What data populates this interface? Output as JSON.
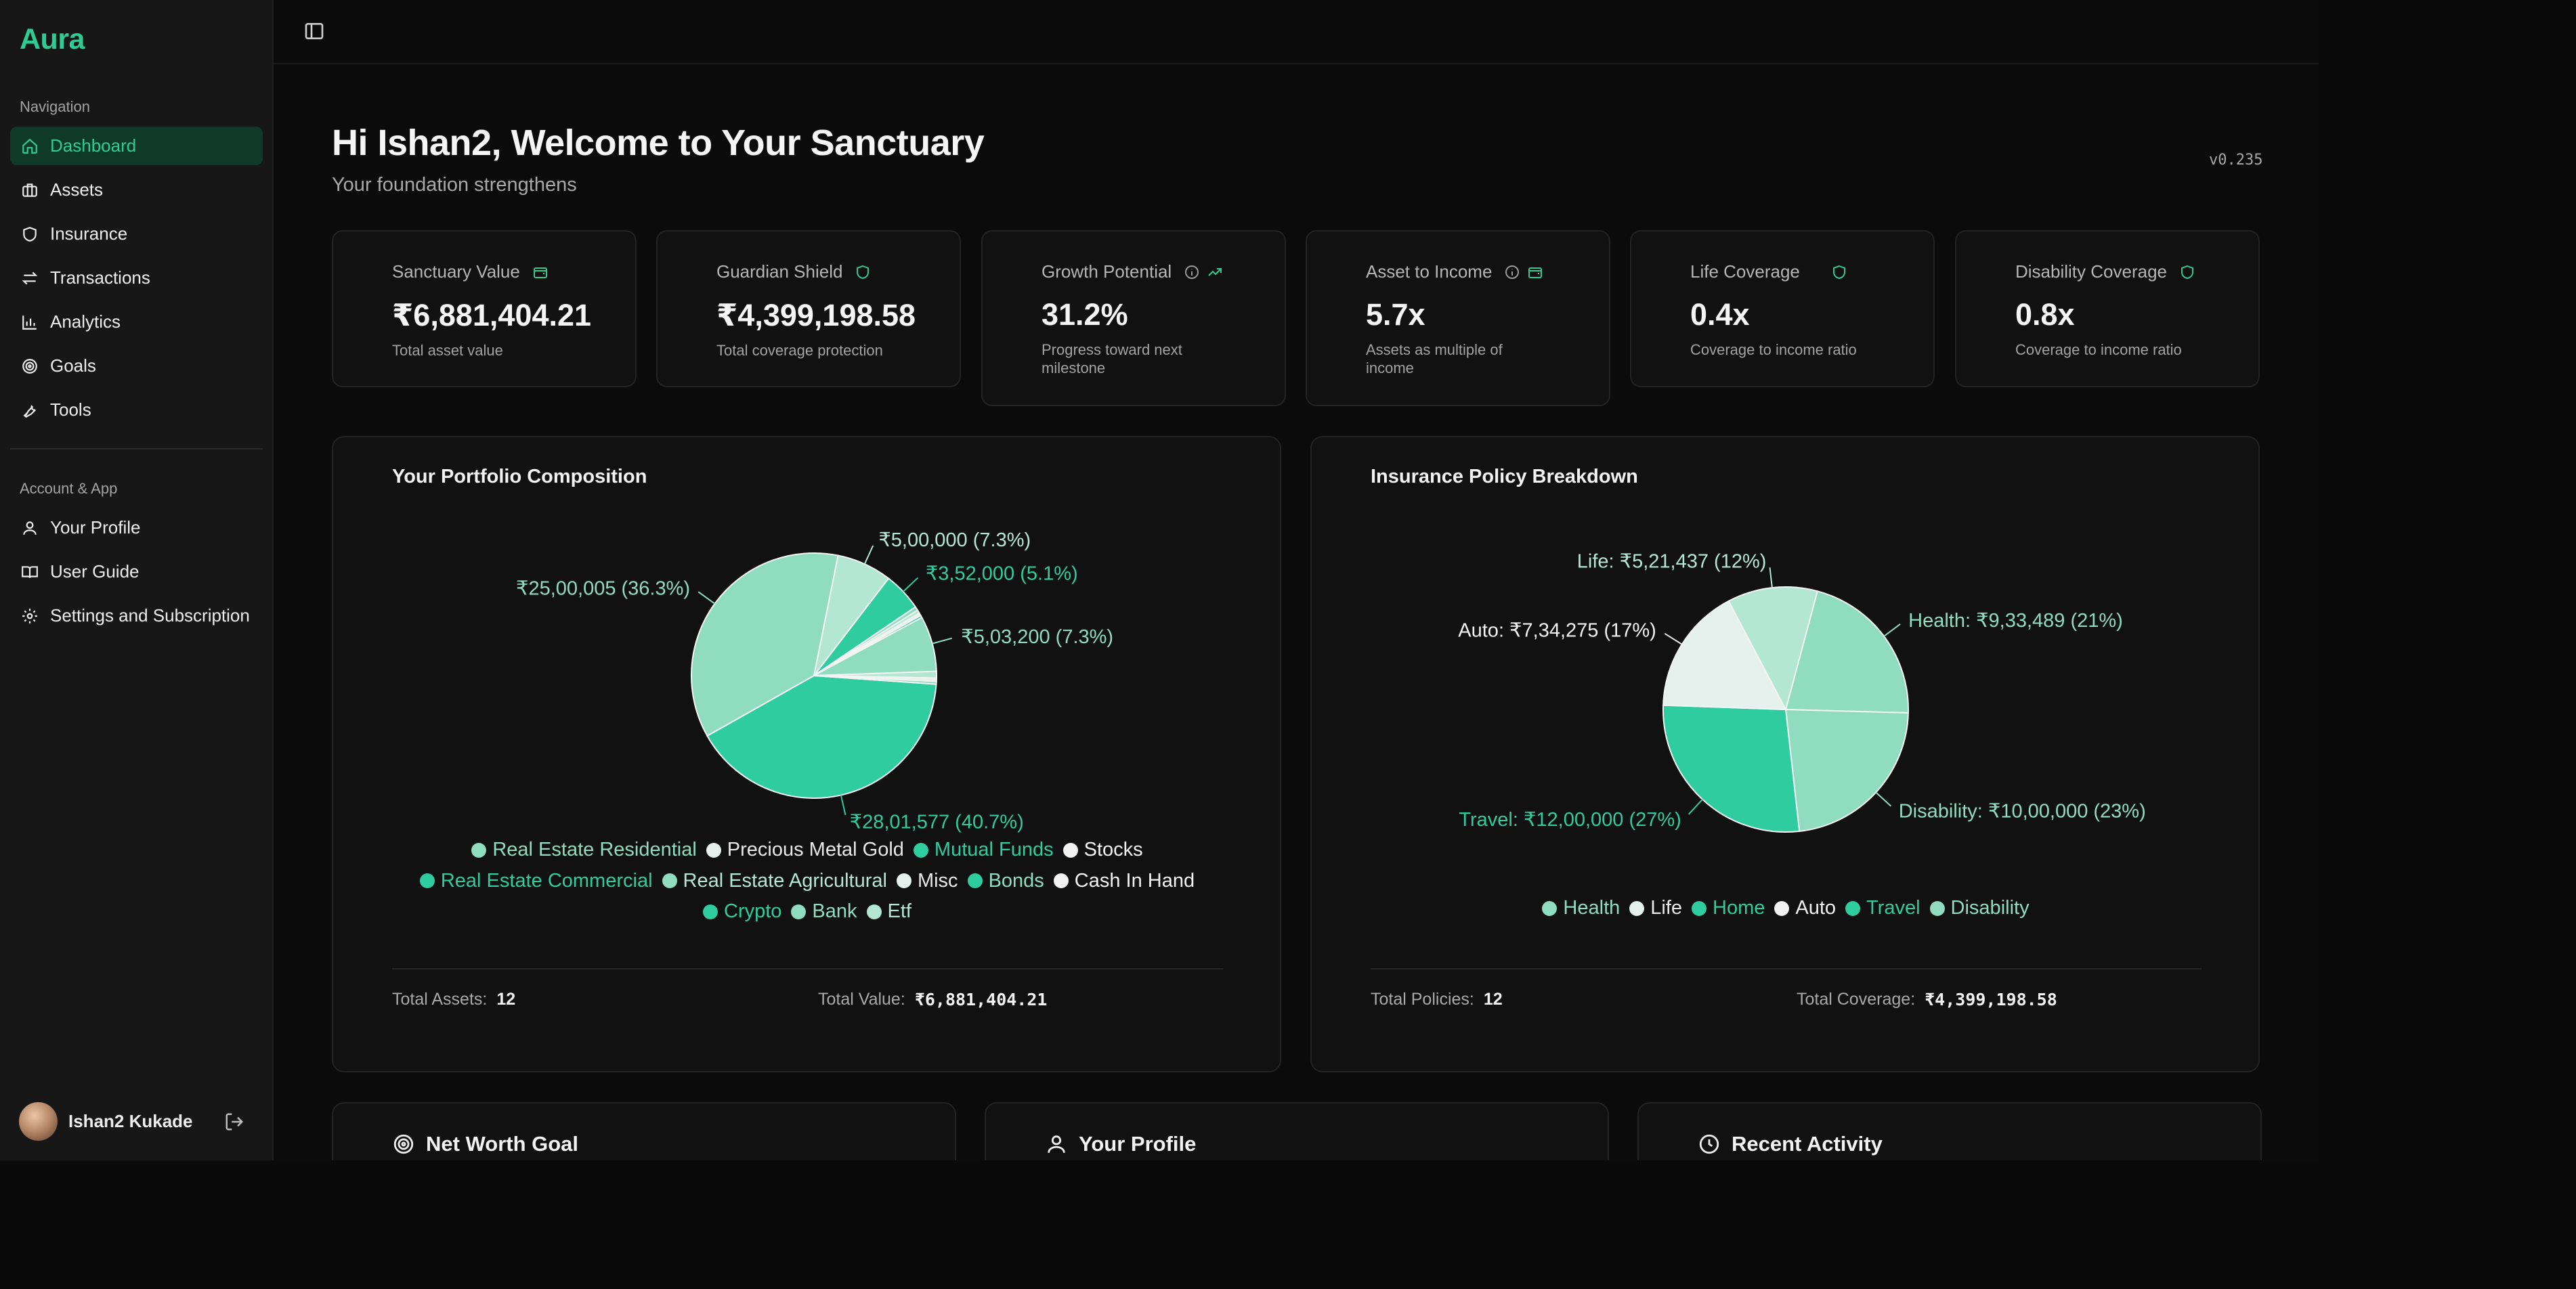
{
  "app": {
    "brand": "Aura",
    "version": "v0.235"
  },
  "sidebar": {
    "nav_label": "Navigation",
    "items": [
      {
        "label": "Dashboard",
        "icon": "home-icon",
        "active": true
      },
      {
        "label": "Assets",
        "icon": "briefcase-icon"
      },
      {
        "label": "Insurance",
        "icon": "shield-icon"
      },
      {
        "label": "Transactions",
        "icon": "arrows-icon"
      },
      {
        "label": "Analytics",
        "icon": "bar-chart-icon"
      },
      {
        "label": "Goals",
        "icon": "target-icon"
      },
      {
        "label": "Tools",
        "icon": "wrench-icon"
      }
    ],
    "account_label": "Account & App",
    "account_items": [
      {
        "label": "Your Profile",
        "icon": "user-icon"
      },
      {
        "label": "User Guide",
        "icon": "book-icon"
      },
      {
        "label": "Settings and Subscription",
        "icon": "gear-icon"
      }
    ],
    "user": {
      "name": "Ishan2 Kukade"
    }
  },
  "header": {
    "greeting": "Hi Ishan2, Welcome to Your Sanctuary",
    "subtitle": "Your foundation strengthens"
  },
  "stats": [
    {
      "label": "Sanctuary Value",
      "value": "₹6,881,404.21",
      "desc": "Total asset value"
    },
    {
      "label": "Guardian Shield",
      "value": "₹4,399,198.58",
      "desc": "Total coverage protection"
    },
    {
      "label": "Growth Potential",
      "value": "31.2%",
      "desc": "Progress toward next milestone"
    },
    {
      "label": "Asset to Income",
      "value": "5.7x",
      "desc": "Assets as multiple of income"
    },
    {
      "label": "Life Coverage",
      "value": "0.4x",
      "desc": "Coverage to income ratio"
    },
    {
      "label": "Disability Coverage",
      "value": "0.8x",
      "desc": "Coverage to income ratio"
    }
  ],
  "portfolio": {
    "title": "Your Portfolio Composition",
    "total_assets_label": "Total Assets:",
    "total_assets": "12",
    "total_value_label": "Total Value:",
    "total_value": "₹6,881,404.21"
  },
  "insurance": {
    "title": "Insurance Policy Breakdown",
    "total_policies_label": "Total Policies:",
    "total_policies": "12",
    "total_coverage_label": "Total Coverage:",
    "total_coverage": "₹4,399,198.58"
  },
  "bottom_cards": [
    {
      "title": "Net Worth Goal",
      "icon": "target-icon"
    },
    {
      "title": "Your Profile",
      "icon": "user-icon"
    },
    {
      "title": "Recent Activity",
      "icon": "clock-icon"
    }
  ],
  "colors": {
    "accent": "#2ecc94",
    "slices": [
      "#2ecc9f",
      "#8fdcc0",
      "#b4e6d4",
      "#e4f1ec"
    ]
  },
  "chart_data": [
    {
      "type": "pie",
      "title": "Your Portfolio Composition",
      "slices": [
        {
          "name": "Real Estate Residential",
          "value": 2801577,
          "percent": 40.7,
          "label": "₹28,01,577 (40.7%)",
          "color": "#2ecc9f"
        },
        {
          "name": "Precious Metal Gold",
          "value": 2500005,
          "percent": 36.3,
          "label": "₹25,00,005 (36.3%)",
          "color": "#8fdcc0"
        },
        {
          "name": "Mutual Funds",
          "value": 500000,
          "percent": 7.3,
          "label": "₹5,00,000 (7.3%)",
          "color": "#b4e6d4"
        },
        {
          "name": "Stocks",
          "value": 352000,
          "percent": 5.1,
          "label": "₹3,52,000 (5.1%)",
          "color": "#2ecc9f"
        },
        {
          "name": "Real Estate Commercial",
          "value": 35000,
          "percent": 0.5,
          "label": "",
          "color": "#8fdcc0"
        },
        {
          "name": "Real Estate Agricultural",
          "value": 30000,
          "percent": 0.4,
          "label": "",
          "color": "#b4e6d4"
        },
        {
          "name": "Misc",
          "value": 25000,
          "percent": 0.4,
          "label": "",
          "color": "#e4f1ec"
        },
        {
          "name": "Bonds",
          "value": 20000,
          "percent": 0.3,
          "label": "",
          "color": "#2ecc9f"
        },
        {
          "name": "Cash In Hand",
          "value": 503200,
          "percent": 7.3,
          "label": "₹5,03,200 (7.3%)",
          "color": "#8fdcc0"
        },
        {
          "name": "Crypto",
          "value": 60000,
          "percent": 0.9,
          "label": "",
          "color": "#b4e6d4"
        },
        {
          "name": "Bank",
          "value": 30000,
          "percent": 0.4,
          "label": "",
          "color": "#e4f1ec"
        },
        {
          "name": "Etf",
          "value": 25000,
          "percent": 0.4,
          "label": "",
          "color": "#8fdcc0"
        }
      ],
      "legend": [
        {
          "name": "Real Estate Residential",
          "color": "#8fdcc0",
          "text": "#8fdcc0"
        },
        {
          "name": "Precious Metal Gold",
          "color": "#e4f1ec",
          "text": "#e8e8e8"
        },
        {
          "name": "Mutual Funds",
          "color": "#2ecc9f",
          "text": "#2ecc9f"
        },
        {
          "name": "Stocks",
          "color": "#f2f2f2",
          "text": "#f2f2f2"
        },
        {
          "name": "Real Estate Commercial",
          "color": "#2ecc9f",
          "text": "#2ecc9f"
        },
        {
          "name": "Real Estate Agricultural",
          "color": "#8fdcc0",
          "text": "#b4e6d4"
        },
        {
          "name": "Misc",
          "color": "#e4f1ec",
          "text": "#e8e8e8"
        },
        {
          "name": "Bonds",
          "color": "#2ecc9f",
          "text": "#8fdcc0"
        },
        {
          "name": "Cash In Hand",
          "color": "#f2f2f2",
          "text": "#f2f2f2"
        },
        {
          "name": "Crypto",
          "color": "#2ecc9f",
          "text": "#2ecc9f"
        },
        {
          "name": "Bank",
          "color": "#8fdcc0",
          "text": "#8fdcc0"
        },
        {
          "name": "Etf",
          "color": "#b4e6d4",
          "text": "#b4e6d4"
        }
      ]
    },
    {
      "type": "pie",
      "title": "Insurance Policy Breakdown",
      "slices": [
        {
          "name": "Health",
          "value": 933489,
          "percent": 21,
          "label": "Health: ₹9,33,489 (21%)",
          "color": "#8fdcc0"
        },
        {
          "name": "Disability",
          "value": 1000000,
          "percent": 23,
          "label": "Disability: ₹10,00,000 (23%)",
          "color": "#8fdcc0"
        },
        {
          "name": "Travel",
          "value": 1200000,
          "percent": 27,
          "label": "Travel: ₹12,00,000 (27%)",
          "color": "#2ecc9f"
        },
        {
          "name": "Auto",
          "value": 734275,
          "percent": 17,
          "label": "Auto: ₹7,34,275 (17%)",
          "color": "#e4f1ec"
        },
        {
          "name": "Life",
          "value": 521437,
          "percent": 12,
          "label": "Life: ₹5,21,437 (12%)",
          "color": "#b4e6d4"
        }
      ],
      "legend": [
        {
          "name": "Health",
          "color": "#8fdcc0",
          "text": "#8fdcc0"
        },
        {
          "name": "Life",
          "color": "#e4f1ec",
          "text": "#e8e8e8"
        },
        {
          "name": "Home",
          "color": "#2ecc9f",
          "text": "#2ecc9f"
        },
        {
          "name": "Auto",
          "color": "#f2f2f2",
          "text": "#f2f2f2"
        },
        {
          "name": "Travel",
          "color": "#2ecc9f",
          "text": "#2ecc9f"
        },
        {
          "name": "Disability",
          "color": "#8fdcc0",
          "text": "#8fdcc0"
        }
      ]
    }
  ]
}
